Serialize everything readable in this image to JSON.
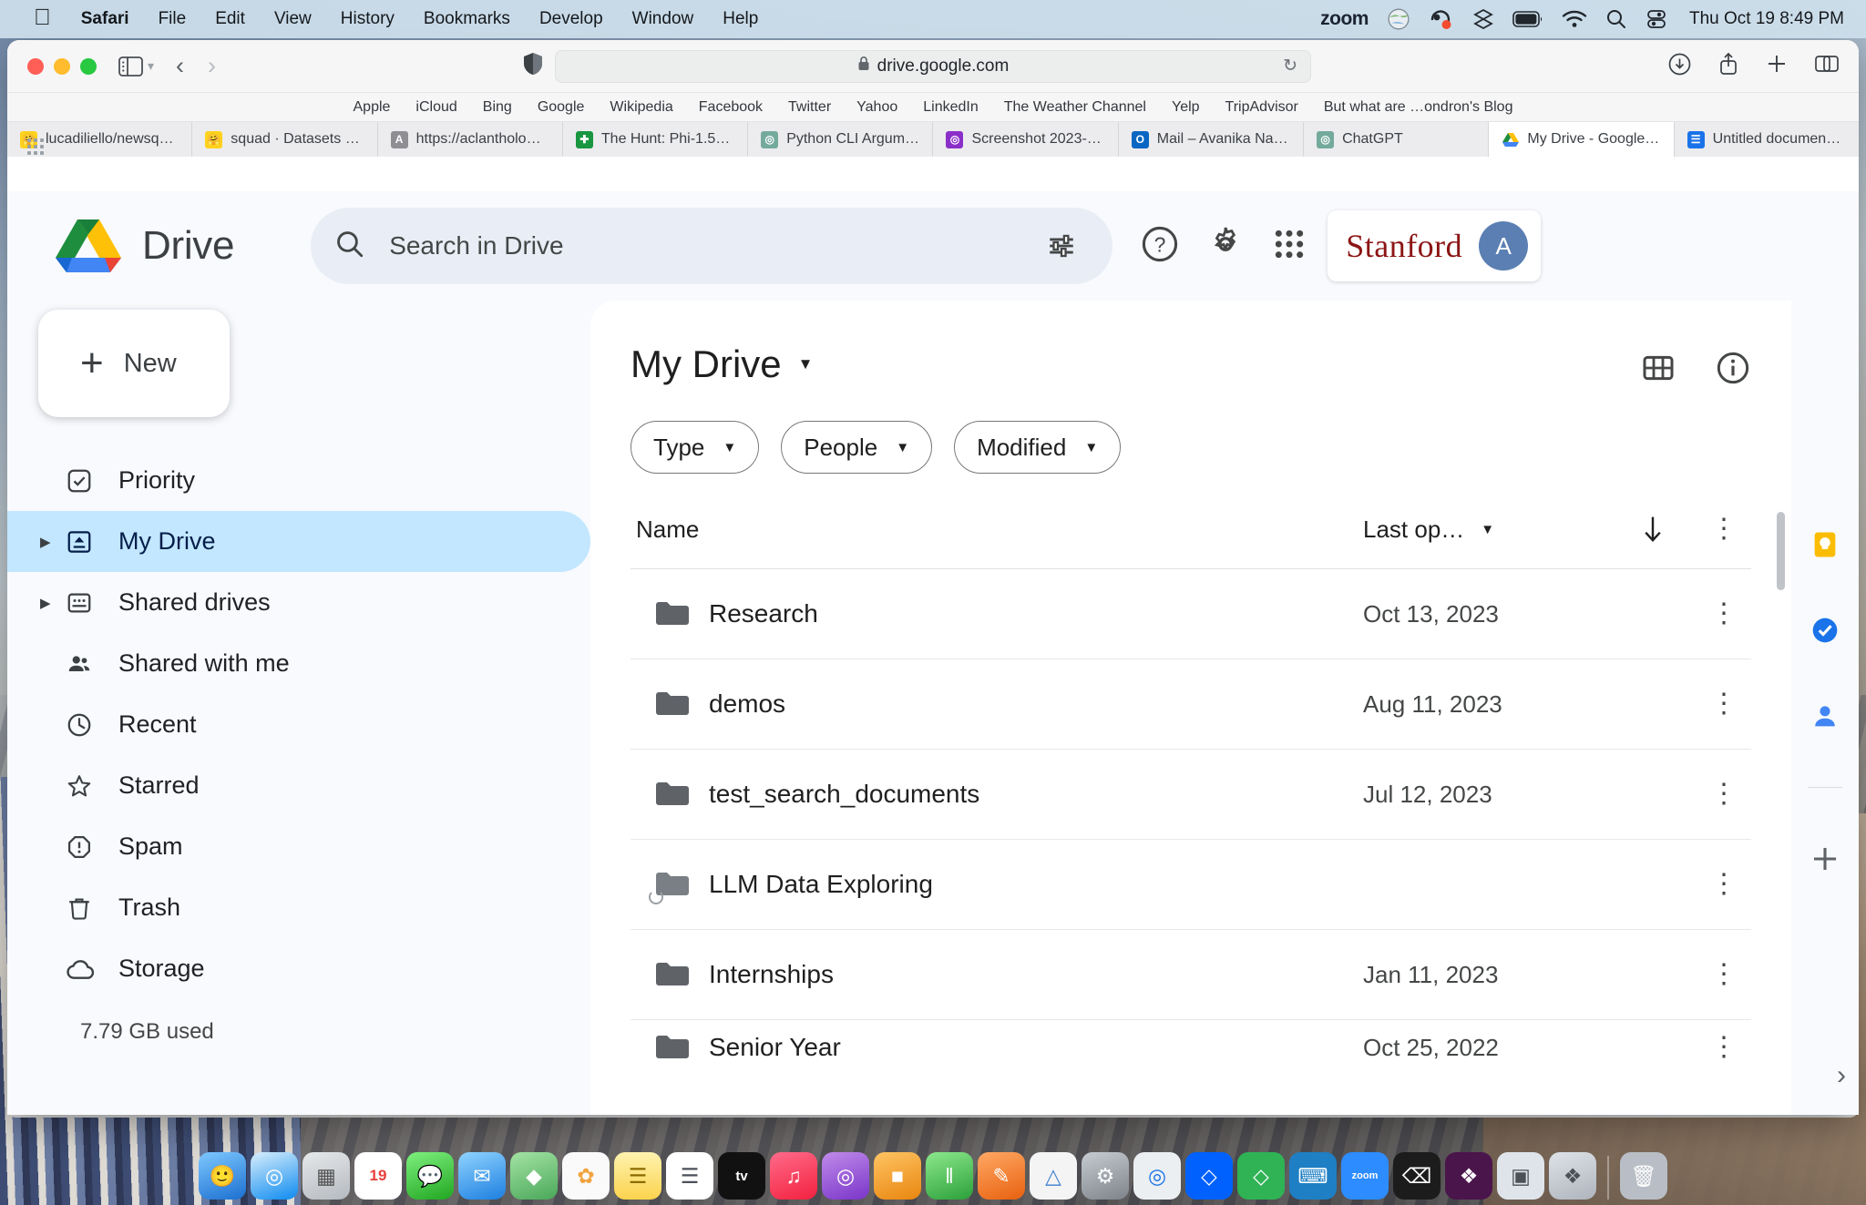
{
  "menubar": {
    "apple_icon": "apple-logo",
    "items": [
      {
        "label": "Safari",
        "bold": true
      },
      {
        "label": "File",
        "bold": false
      },
      {
        "label": "Edit",
        "bold": false
      },
      {
        "label": "View",
        "bold": false
      },
      {
        "label": "History",
        "bold": false
      },
      {
        "label": "Bookmarks",
        "bold": false
      },
      {
        "label": "Develop",
        "bold": false
      },
      {
        "label": "Window",
        "bold": false
      },
      {
        "label": "Help",
        "bold": false
      }
    ],
    "status": {
      "zoom_label": "zoom",
      "icons": [
        "globe-icon",
        "mic-record-icon",
        "dropbox-icon",
        "battery-icon",
        "wifi-icon",
        "spotlight-search-icon",
        "control-center-icon"
      ],
      "clock": "Thu Oct 19  8:49 PM"
    }
  },
  "browser": {
    "toolbar": {
      "sidebar_icon": "sidebar-toggle-icon",
      "sidebar_chevron": "chevron-down-icon",
      "back_icon": "back-chevron-icon",
      "forward_icon": "forward-chevron-icon",
      "shield_icon": "privacy-shield-icon",
      "url": "drive.google.com",
      "lock_icon": "lock-icon",
      "reload_icon": "reload-icon",
      "download_icon": "download-icon",
      "share_icon": "share-icon",
      "new_tab_icon": "plus-icon",
      "tab_overview_icon": "tab-overview-icon"
    },
    "bookmarks": [
      "Apple",
      "iCloud",
      "Bing",
      "Google",
      "Wikipedia",
      "Facebook",
      "Twitter",
      "Yahoo",
      "LinkedIn",
      "The Weather Channel",
      "Yelp",
      "TripAdvisor",
      "But what are …ondron's Blog"
    ],
    "tabs": [
      {
        "label": "lucadiliello/newsq…",
        "favicon": "🤗",
        "bg": "#ffd21e",
        "fg": "#5a4500",
        "active": false
      },
      {
        "label": "squad · Datasets a…",
        "favicon": "🤗",
        "bg": "#ffd21e",
        "fg": "#5a4500",
        "active": false
      },
      {
        "label": "https://aclantholo…",
        "favicon": "A",
        "bg": "#8e8e93",
        "fg": "#ffffff",
        "active": false
      },
      {
        "label": "The Hunt: Phi-1.5…",
        "favicon": "✚",
        "bg": "#1a9641",
        "fg": "#ffffff",
        "active": false
      },
      {
        "label": "Python CLI Argum…",
        "favicon": "◎",
        "bg": "#74aa9c",
        "fg": "#ffffff",
        "active": false
      },
      {
        "label": "Screenshot 2023-…",
        "favicon": "◎",
        "bg": "#8b2fc9",
        "fg": "#ffffff",
        "active": false
      },
      {
        "label": "Mail – Avanika Nar…",
        "favicon": "O",
        "bg": "#0a66c2",
        "fg": "#ffffff",
        "active": false
      },
      {
        "label": "ChatGPT",
        "favicon": "◎",
        "bg": "#74aa9c",
        "fg": "#ffffff",
        "active": false
      },
      {
        "label": "My Drive - Google…",
        "favicon": "▲",
        "bg": "#ffffff",
        "fg": "#1a73e8",
        "active": true
      },
      {
        "label": "Untitled documen…",
        "favicon": "☰",
        "bg": "#1a73e8",
        "fg": "#ffffff",
        "active": false
      }
    ]
  },
  "drive": {
    "app_name": "Drive",
    "logo_icon": "google-drive-logo",
    "search": {
      "icon": "search-icon",
      "placeholder": "Search in Drive",
      "value": "",
      "tune_icon": "search-options-icon"
    },
    "header_icons": [
      "help-icon",
      "settings-gear-icon",
      "google-apps-grid-icon"
    ],
    "account": {
      "org_name": "Stanford",
      "avatar_initial": "A"
    },
    "sidebar": {
      "new_button": {
        "label": "New",
        "icon": "plus-icon"
      },
      "items": [
        {
          "label": "Priority",
          "icon": "priority-check-icon",
          "caret": false,
          "active": false
        },
        {
          "label": "My Drive",
          "icon": "my-drive-icon",
          "caret": true,
          "active": true
        },
        {
          "label": "Shared drives",
          "icon": "shared-drives-icon",
          "caret": true,
          "active": false
        },
        {
          "label": "Shared with me",
          "icon": "shared-with-me-icon",
          "caret": false,
          "active": false
        },
        {
          "label": "Recent",
          "icon": "clock-icon",
          "caret": false,
          "active": false
        },
        {
          "label": "Starred",
          "icon": "star-icon",
          "caret": false,
          "active": false
        },
        {
          "label": "Spam",
          "icon": "spam-icon",
          "caret": false,
          "active": false
        },
        {
          "label": "Trash",
          "icon": "trash-icon",
          "caret": false,
          "active": false
        },
        {
          "label": "Storage",
          "icon": "cloud-icon",
          "caret": false,
          "active": false
        }
      ],
      "storage_used": "7.79 GB used"
    },
    "main": {
      "title": "My Drive",
      "title_dropdown_icon": "chevron-down-icon",
      "view_toggle_icon": "grid-view-icon",
      "details_icon": "info-icon",
      "filters": [
        {
          "label": "Type",
          "icon": "chevron-down-icon"
        },
        {
          "label": "People",
          "icon": "chevron-down-icon"
        },
        {
          "label": "Modified",
          "icon": "chevron-down-icon"
        }
      ],
      "columns": {
        "name": "Name",
        "modified": "Last op…",
        "modified_dropdown_icon": "chevron-down-icon",
        "sort_icon": "sort-descending-arrow-icon",
        "options_icon": "more-options-icon"
      },
      "rows": [
        {
          "name": "Research",
          "date": "Oct 13, 2023",
          "icon": "folder-icon"
        },
        {
          "name": "demos",
          "date": "Aug 11, 2023",
          "icon": "folder-icon"
        },
        {
          "name": "test_search_documents",
          "date": "Jul 12, 2023",
          "icon": "folder-icon"
        },
        {
          "name": "LLM Data Exploring",
          "date": "",
          "icon": "folder-icon"
        },
        {
          "name": "Internships",
          "date": "Jan 11, 2023",
          "icon": "folder-icon"
        },
        {
          "name": "Senior Year",
          "date": "Oct 25, 2022",
          "icon": "folder-icon"
        }
      ]
    },
    "rail": {
      "icons": [
        "google-keep-icon",
        "google-tasks-icon",
        "google-contacts-icon",
        "add-addon-icon",
        "expand-panel-icon"
      ]
    }
  },
  "dock": {
    "apps": [
      {
        "name": "finder-icon",
        "glyph": "🙂",
        "bg": "#2a7fd4"
      },
      {
        "name": "safari-icon",
        "glyph": "◉",
        "bg": "#0d8bf0"
      },
      {
        "name": "launchpad-icon",
        "glyph": "▦",
        "bg": "#8d9199"
      },
      {
        "name": "calendar-icon",
        "glyph": "19",
        "bg": "#ffffff"
      },
      {
        "name": "messages-icon",
        "glyph": "💬",
        "bg": "#3ec64a"
      },
      {
        "name": "mail-icon",
        "glyph": "✉",
        "bg": "#2d9bf0"
      },
      {
        "name": "maps-icon",
        "glyph": "◆",
        "bg": "#63c16a"
      },
      {
        "name": "photos-icon",
        "glyph": "✿",
        "bg": "#f7f7f7"
      },
      {
        "name": "notes-icon",
        "glyph": "☰",
        "bg": "#fcd34d"
      },
      {
        "name": "reminders-icon",
        "glyph": "☰",
        "bg": "#ffffff"
      },
      {
        "name": "appletv-icon",
        "glyph": "tv",
        "bg": "#111111"
      },
      {
        "name": "music-icon",
        "glyph": "♫",
        "bg": "#fb2c53"
      },
      {
        "name": "podcasts-icon",
        "glyph": "◎",
        "bg": "#8c4fd6"
      },
      {
        "name": "keynote-icon",
        "glyph": "■",
        "bg": "#f0a12e"
      },
      {
        "name": "numbers-icon",
        "glyph": "‖",
        "bg": "#3ec64a"
      },
      {
        "name": "pages-icon",
        "glyph": "✎",
        "bg": "#f07a2e"
      },
      {
        "name": "freeform-icon",
        "glyph": "△",
        "bg": "#f2f2f2"
      },
      {
        "name": "settings-icon",
        "glyph": "⚙",
        "bg": "#8d9199"
      },
      {
        "name": "chrome-icon",
        "glyph": "◎",
        "bg": "#e8eaed"
      },
      {
        "name": "dropbox-icon",
        "glyph": "◇",
        "bg": "#0061ff"
      },
      {
        "name": "dropbox2-icon",
        "glyph": "◇",
        "bg": "#3fb950"
      },
      {
        "name": "vscode-icon",
        "glyph": "⌨",
        "bg": "#23a0e8"
      },
      {
        "name": "zoom-icon",
        "glyph": "zoom",
        "bg": "#2d8cff"
      },
      {
        "name": "terminal-icon",
        "glyph": "⌫",
        "bg": "#1c1c1c"
      },
      {
        "name": "slack-icon",
        "glyph": "❖",
        "bg": "#4a154b"
      },
      {
        "name": "preview-icon",
        "glyph": "▣",
        "bg": "#dfe4ea"
      },
      {
        "name": "screenshot-icon",
        "glyph": "❖",
        "bg": "#c8cdd4"
      },
      {
        "name": "trash-icon",
        "glyph": "🗑",
        "bg": "#b9bec6"
      }
    ]
  }
}
